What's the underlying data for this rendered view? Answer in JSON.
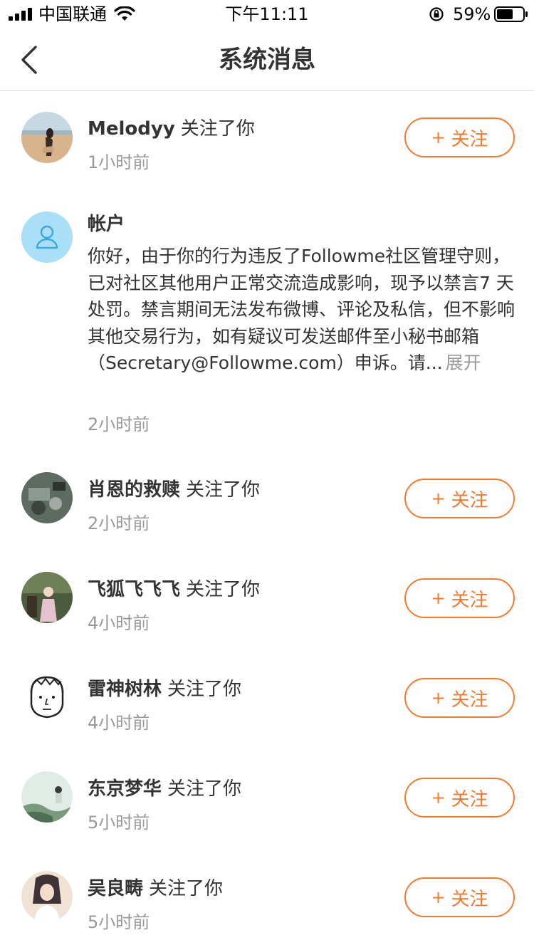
{
  "status_bar": {
    "carrier": "中国联通",
    "time": "下午11:11",
    "battery": "59%"
  },
  "nav": {
    "title": "系统消息"
  },
  "follow_label": "关注",
  "messages": [
    {
      "name": "Melodyy",
      "action": "关注了你",
      "time": "1小时前"
    },
    {
      "title": "帐户",
      "body": "你好，由于你的行为违反了Followme社区管理守则，已对社区其他用户正常交流造成影响，现予以禁言7 天处罚。禁言期间无法发布微博、评论及私信，但不影响其他交易行为，如有疑议可发送邮件至小秘书邮箱（Secretary@Followme.com）申诉。请...",
      "expand": "展开",
      "time": "2小时前"
    },
    {
      "name": "肖恩的救赎",
      "action": "关注了你",
      "time": "2小时前"
    },
    {
      "name": "飞狐飞飞飞",
      "action": "关注了你",
      "time": "4小时前"
    },
    {
      "name": "雷神树林",
      "action": "关注了你",
      "time": "4小时前"
    },
    {
      "name": "东京梦华",
      "action": "关注了你",
      "time": "5小时前"
    },
    {
      "name": "吴良畴",
      "action": "关注了你",
      "time": "5小时前"
    }
  ],
  "colors": {
    "accent": "#f57a2e",
    "muted_text": "#999999",
    "account_avatar_bg": "#a9e0f7"
  }
}
